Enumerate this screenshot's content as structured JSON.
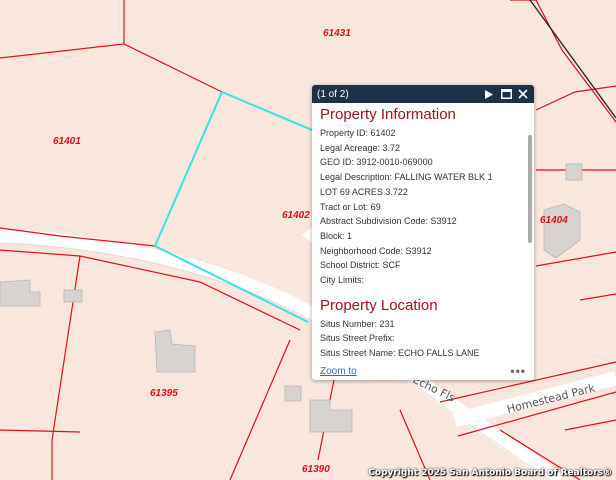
{
  "map": {
    "parcel_labels": [
      "61431",
      "61401",
      "61402",
      "61404",
      "61395",
      "61390"
    ],
    "road_labels": [
      "Homestead Park",
      "Echo Fls"
    ],
    "copyright": "Copyright 2025 San Antonio Board of Realtors®",
    "colors": {
      "background": "#f9e6dc",
      "parcel_line": "#e0101c",
      "selected_parcel": "#33e5e8",
      "road": "#ffffff",
      "building": "#d6d3d0"
    }
  },
  "popup": {
    "count": "(1 of 2)",
    "icons": [
      "play-icon",
      "maximize-icon",
      "close-icon"
    ],
    "sections": [
      {
        "title": "Property Information",
        "fields": [
          "Property ID: 61402",
          "Legal Acreage: 3.72",
          "GEO ID: 3912-0010-069000",
          "Legal Description: FALLING WATER BLK 1",
          "LOT 69 ACRES 3.722",
          "Tract or Lot: 69",
          "Abstract Subdivision Code: S3912",
          "Block: 1",
          "Neighborhood Code: S3912",
          "School District: SCF",
          "City Limits:"
        ]
      },
      {
        "title": "Property Location",
        "fields": [
          "Situs Number: 231",
          "Situs Street Prefix:",
          "Situs Street Name: ECHO FALLS LANE"
        ]
      }
    ],
    "zoom_label": "Zoom to",
    "more_label": "•••",
    "colors": {
      "header": "#1c3148",
      "title": "#a01020",
      "link": "#3a6fb0"
    }
  }
}
